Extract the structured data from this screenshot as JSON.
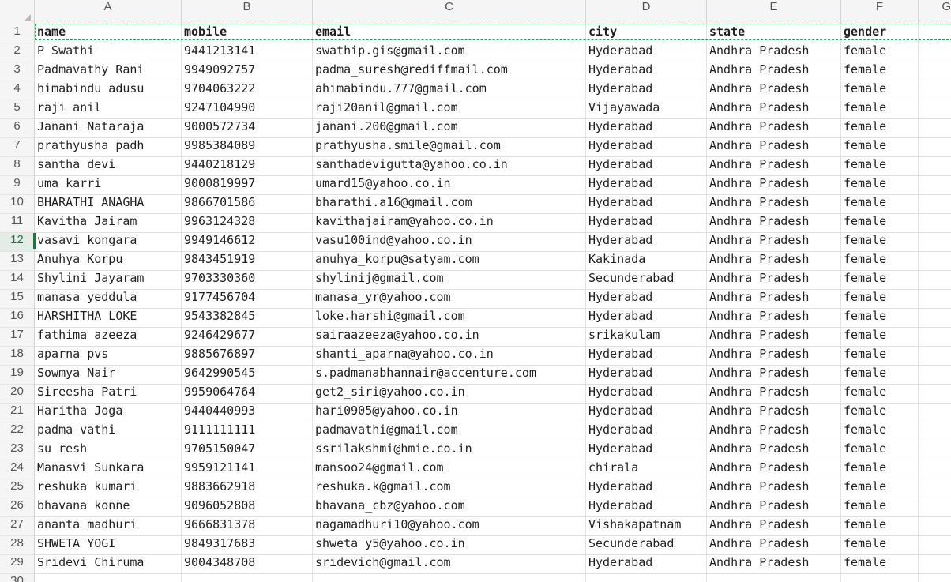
{
  "columns": [
    "A",
    "B",
    "C",
    "D",
    "E",
    "F",
    "G"
  ],
  "rows": [
    {
      "n": "1",
      "cells": [
        "name",
        "mobile",
        "email",
        "city",
        "state",
        "gender",
        ""
      ]
    },
    {
      "n": "2",
      "cells": [
        "P Swathi",
        "9441213141",
        "swathip.gis@gmail.com",
        "Hyderabad",
        "Andhra Pradesh",
        "female",
        ""
      ]
    },
    {
      "n": "3",
      "cells": [
        "Padmavathy Rani",
        "9949092757",
        "padma_suresh@rediffmail.com",
        "Hyderabad",
        "Andhra Pradesh",
        "female",
        ""
      ]
    },
    {
      "n": "4",
      "cells": [
        "himabindu adusu",
        "9704063222",
        "ahimabindu.777@gmail.com",
        "Hyderabad",
        "Andhra Pradesh",
        "female",
        ""
      ]
    },
    {
      "n": "5",
      "cells": [
        "raji anil",
        "9247104990",
        "raji20anil@gmail.com",
        "Vijayawada",
        "Andhra Pradesh",
        "female",
        ""
      ]
    },
    {
      "n": "6",
      "cells": [
        "Janani Nataraja",
        "9000572734",
        "janani.200@gmail.com",
        "Hyderabad",
        "Andhra Pradesh",
        "female",
        ""
      ]
    },
    {
      "n": "7",
      "cells": [
        "prathyusha padh",
        "9985384089",
        "prathyusha.smile@gmail.com",
        "Hyderabad",
        "Andhra Pradesh",
        "female",
        ""
      ]
    },
    {
      "n": "8",
      "cells": [
        "santha devi",
        "9440218129",
        "santhadevigutta@yahoo.co.in",
        "Hyderabad",
        "Andhra Pradesh",
        "female",
        ""
      ]
    },
    {
      "n": "9",
      "cells": [
        "uma karri",
        "9000819997",
        "umard15@yahoo.co.in",
        "Hyderabad",
        "Andhra Pradesh",
        "female",
        ""
      ]
    },
    {
      "n": "10",
      "cells": [
        "BHARATHI ANAGHA",
        "9866701586",
        "bharathi.a16@gmail.com",
        "Hyderabad",
        "Andhra Pradesh",
        "female",
        ""
      ]
    },
    {
      "n": "11",
      "cells": [
        "Kavitha Jairam",
        "9963124328",
        "kavithajairam@yahoo.co.in",
        "Hyderabad",
        "Andhra Pradesh",
        "female",
        ""
      ]
    },
    {
      "n": "12",
      "cells": [
        "vasavi kongara",
        "9949146612",
        "vasu100ind@yahoo.co.in",
        "Hyderabad",
        "Andhra Pradesh",
        "female",
        ""
      ]
    },
    {
      "n": "13",
      "cells": [
        "Anuhya Korpu",
        "9843451919",
        "anuhya_korpu@satyam.com",
        "Kakinada",
        "Andhra Pradesh",
        "female",
        ""
      ]
    },
    {
      "n": "14",
      "cells": [
        "Shylini Jayaram",
        "9703330360",
        "shylinij@gmail.com",
        "Secunderabad",
        "Andhra Pradesh",
        "female",
        ""
      ]
    },
    {
      "n": "15",
      "cells": [
        "manasa yeddula",
        "9177456704",
        "manasa_yr@yahoo.com",
        "Hyderabad",
        "Andhra Pradesh",
        "female",
        ""
      ]
    },
    {
      "n": "16",
      "cells": [
        "HARSHITHA LOKE",
        "9543382845",
        "loke.harshi@gmail.com",
        "Hyderabad",
        "Andhra Pradesh",
        "female",
        ""
      ]
    },
    {
      "n": "17",
      "cells": [
        "fathima azeeza",
        "9246429677",
        "sairaazeeza@yahoo.co.in",
        "srikakulam",
        "Andhra Pradesh",
        "female",
        ""
      ]
    },
    {
      "n": "18",
      "cells": [
        "aparna pvs",
        "9885676897",
        "shanti_aparna@yahoo.co.in",
        "Hyderabad",
        "Andhra Pradesh",
        "female",
        ""
      ]
    },
    {
      "n": "19",
      "cells": [
        "Sowmya Nair",
        "9642990545",
        "s.padmanabhannair@accenture.com",
        "Hyderabad",
        "Andhra Pradesh",
        "female",
        ""
      ]
    },
    {
      "n": "20",
      "cells": [
        "Sireesha Patri",
        "9959064764",
        "get2_siri@yahoo.co.in",
        "Hyderabad",
        "Andhra Pradesh",
        "female",
        ""
      ]
    },
    {
      "n": "21",
      "cells": [
        "Haritha Joga",
        "9440440993",
        "hari0905@yahoo.co.in",
        "Hyderabad",
        "Andhra Pradesh",
        "female",
        ""
      ]
    },
    {
      "n": "22",
      "cells": [
        "padma vathi",
        "9111111111",
        "padmavathi@gmail.com",
        "Hyderabad",
        "Andhra Pradesh",
        "female",
        ""
      ]
    },
    {
      "n": "23",
      "cells": [
        "su resh",
        "9705150047",
        "ssrilakshmi@hmie.co.in",
        "Hyderabad",
        "Andhra Pradesh",
        "female",
        ""
      ]
    },
    {
      "n": "24",
      "cells": [
        "Manasvi Sunkara",
        "9959121141",
        "mansoo24@gmail.com",
        "chirala",
        "Andhra Pradesh",
        "female",
        ""
      ]
    },
    {
      "n": "25",
      "cells": [
        "reshuka kumari",
        "9883662918",
        "reshuka.k@gmail.com",
        "Hyderabad",
        "Andhra Pradesh",
        "female",
        ""
      ]
    },
    {
      "n": "26",
      "cells": [
        "bhavana konne",
        "9096052808",
        "bhavana_cbz@yahoo.com",
        "Hyderabad",
        "Andhra Pradesh",
        "female",
        ""
      ]
    },
    {
      "n": "27",
      "cells": [
        "ananta madhuri",
        "9666831378",
        "nagamadhuri10@yahoo.com",
        "Vishakapatnam",
        "Andhra Pradesh",
        "female",
        ""
      ]
    },
    {
      "n": "28",
      "cells": [
        "SHWETA YOGI",
        "9849317683",
        "shweta_y5@yahoo.co.in",
        "Secunderabad",
        "Andhra Pradesh",
        "female",
        ""
      ]
    },
    {
      "n": "29",
      "cells": [
        "Sridevi Chiruma",
        "9004348708",
        "sridevich@gmail.com",
        "Hyderabad",
        "Andhra Pradesh",
        "female",
        ""
      ]
    },
    {
      "n": "30",
      "cells": [
        "",
        "",
        "",
        "",
        "",
        "",
        ""
      ]
    }
  ],
  "active_row": "12",
  "colors": {
    "accent": "#217346",
    "marquee": "#2e9e5b"
  }
}
